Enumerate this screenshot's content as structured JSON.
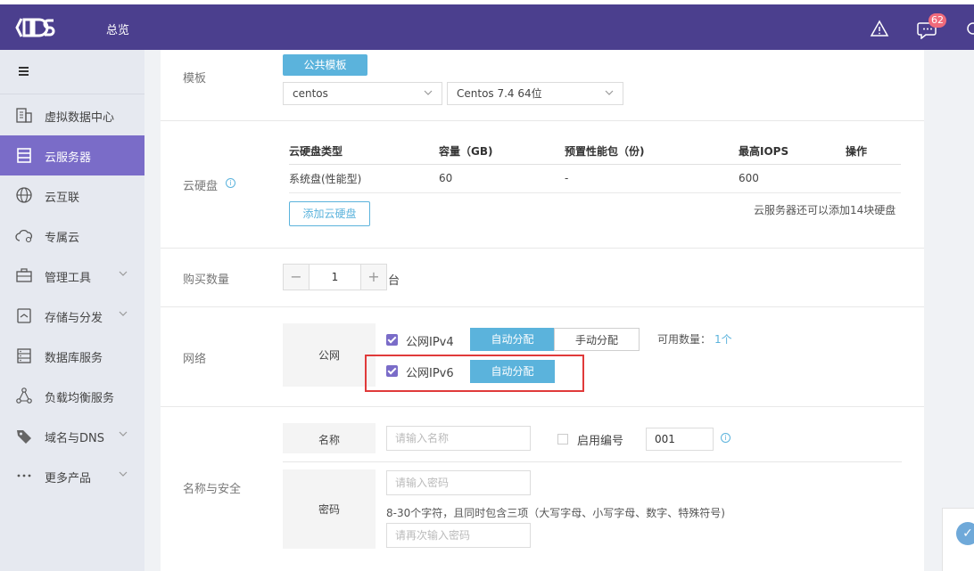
{
  "header": {
    "title": "总览",
    "message_count": "62"
  },
  "sidebar": {
    "items": [
      {
        "label": "虚拟数据中心",
        "icon": "building-icon"
      },
      {
        "label": "云服务器",
        "icon": "server-icon"
      },
      {
        "label": "云互联",
        "icon": "globe-icon"
      },
      {
        "label": "专属云",
        "icon": "cloud-icon"
      },
      {
        "label": "管理工具",
        "icon": "toolbox-icon"
      },
      {
        "label": "存储与分发",
        "icon": "storage-icon"
      },
      {
        "label": "数据库服务",
        "icon": "database-icon"
      },
      {
        "label": "负载均衡服务",
        "icon": "load-balancer-icon"
      },
      {
        "label": "域名与DNS",
        "icon": "tag-icon"
      },
      {
        "label": "更多产品",
        "icon": "more-icon"
      }
    ],
    "active_index": 1
  },
  "template": {
    "label": "模板",
    "tab_label": "公共模板",
    "os_select": "centos",
    "version_select": "Centos 7.4 64位"
  },
  "disk": {
    "label": "云硬盘",
    "columns": [
      "云硬盘类型",
      "容量（GB)",
      "预置性能包（份)",
      "最高IOPS",
      "操作"
    ],
    "rows": [
      [
        "系统盘(性能型)",
        "60",
        "-",
        "600",
        ""
      ]
    ],
    "add_button": "添加云硬盘",
    "hint": "云服务器还可以添加14块硬盘"
  },
  "quantity": {
    "label": "购买数量",
    "value": "1",
    "unit": "台",
    "minus": "−",
    "plus": "+"
  },
  "network": {
    "label": "网络",
    "public_label": "公网",
    "ipv4_label": "公网IPv4",
    "ipv6_label": "公网IPv6",
    "auto_assign": "自动分配",
    "manual_assign": "手动分配",
    "available_label": "可用数量：",
    "available_value": "1个"
  },
  "security": {
    "label": "名称与安全",
    "name_label": "名称",
    "name_placeholder": "请输入名称",
    "numbering_label": "启用编号",
    "numbering_value": "001",
    "password_label": "密码",
    "password_placeholder": "请输入密码",
    "password_hint": "8-30个字符，且同时包含三项（大写字母、小写字母、数字、特殊符号)",
    "confirm_placeholder": "请再次输入密码"
  }
}
